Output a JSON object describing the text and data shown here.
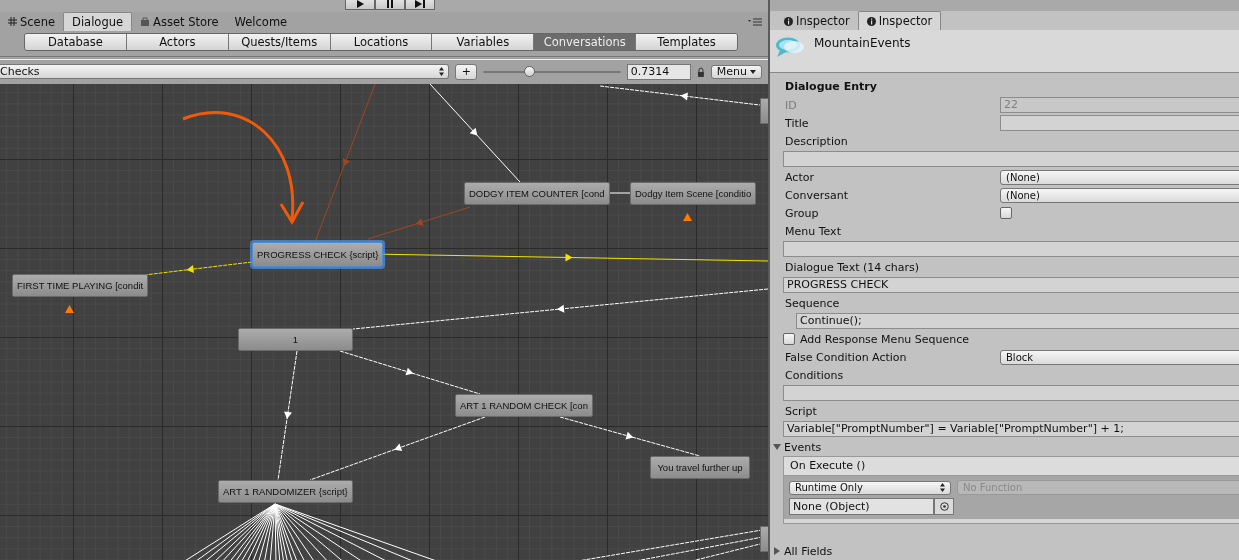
{
  "editor_tabs": [
    {
      "label": "Scene",
      "selected": false
    },
    {
      "label": "Dialogue",
      "selected": true
    },
    {
      "label": "Asset Store",
      "selected": false
    },
    {
      "label": "Welcome",
      "selected": false
    }
  ],
  "inspector_tabs": [
    {
      "label": "Inspector",
      "selected": false
    },
    {
      "label": "Inspector",
      "selected": true
    }
  ],
  "section_tabs": [
    {
      "label": "Database",
      "selected": false
    },
    {
      "label": "Actors",
      "selected": false
    },
    {
      "label": "Quests/Items",
      "selected": false
    },
    {
      "label": "Locations",
      "selected": false
    },
    {
      "label": "Variables",
      "selected": false
    },
    {
      "label": "Conversations",
      "selected": true
    },
    {
      "label": "Templates",
      "selected": false
    }
  ],
  "conversation_bar": {
    "conversation": "Checks",
    "add_button": "+",
    "zoom": {
      "level": 0.34
    },
    "zoom_value": "0.7314",
    "menu": "Menu"
  },
  "nodes": [
    {
      "text": "DODGY ITEM COUNTER [cond",
      "selected": false,
      "alert": false
    },
    {
      "text": "Dodgy Item Scene [conditio",
      "selected": false,
      "alert": true
    },
    {
      "text": "PROGRESS CHECK {script}",
      "selected": true,
      "alert": false
    },
    {
      "text": "FIRST TIME PLAYING [condit",
      "selected": false,
      "alert": true
    },
    {
      "text": "1",
      "selected": false,
      "alert": false
    },
    {
      "text": "ART 1 RANDOM CHECK [con",
      "selected": false,
      "alert": false
    },
    {
      "text": "You travel further up",
      "selected": false,
      "alert": false
    },
    {
      "text": "ART 1 RANDOMIZER {script}",
      "selected": false,
      "alert": false
    }
  ],
  "inspector": {
    "title": "MountainEvents",
    "section": "Dialogue Entry",
    "fields": [
      {
        "kind": "text",
        "label": "ID",
        "value": "22",
        "disabled": true
      },
      {
        "kind": "text",
        "label": "Title",
        "disabled": false
      },
      {
        "kind": "wide",
        "label": "Description",
        "disabled": false
      },
      {
        "kind": "dropdown",
        "label": "Actor",
        "value": "(None)",
        "disabled": false
      },
      {
        "kind": "dropdown",
        "label": "Conversant",
        "value": "(None)",
        "disabled": false
      },
      {
        "kind": "checkbox",
        "label": "Group",
        "checked": false,
        "disabled": false
      },
      {
        "kind": "wide",
        "label": "Menu Text",
        "disabled": false
      },
      {
        "kind": "wide",
        "label": "Dialogue Text (14 chars)",
        "value": "PROGRESS CHECK",
        "disabled": false
      },
      {
        "kind": "indented",
        "label": "Sequence",
        "value": "Continue();",
        "disabled": false
      },
      {
        "kind": "toggle",
        "label": "Add Response Menu Sequence",
        "checked": false,
        "disabled": false
      },
      {
        "kind": "dropdown",
        "label": "False Condition Action",
        "value": "Block",
        "disabled": false
      },
      {
        "kind": "wide",
        "label": "Conditions",
        "disabled": false
      },
      {
        "kind": "wide",
        "label": "Script",
        "value": "Variable[\"PromptNumber\"] = Variable[\"PromptNumber\"] + 1;",
        "disabled": false
      }
    ],
    "events": {
      "label": "Events",
      "expanded": true,
      "event_name": "On Execute ()",
      "call_state": "Runtime Only",
      "function": "No Function",
      "target": "None (Object)"
    },
    "all_fields": {
      "label": "All Fields",
      "expanded": false
    }
  }
}
